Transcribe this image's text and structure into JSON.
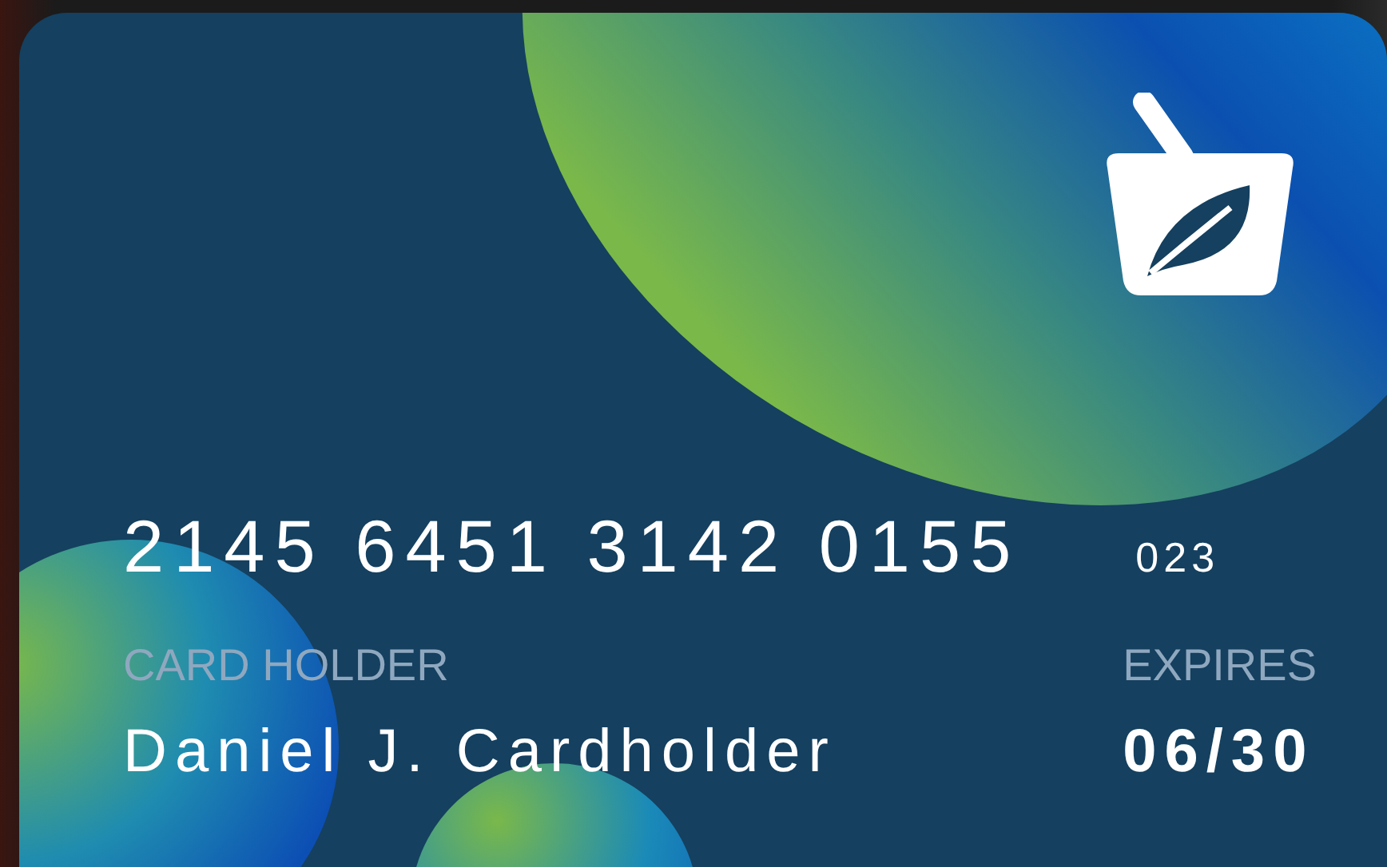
{
  "card": {
    "number": "2145 6451 3142 0155",
    "cvv": "023",
    "holder_label": "CARD HOLDER",
    "holder_name": "Daniel J. Cardholder",
    "expires_label": "EXPIRES",
    "expires_value": "06/30"
  }
}
